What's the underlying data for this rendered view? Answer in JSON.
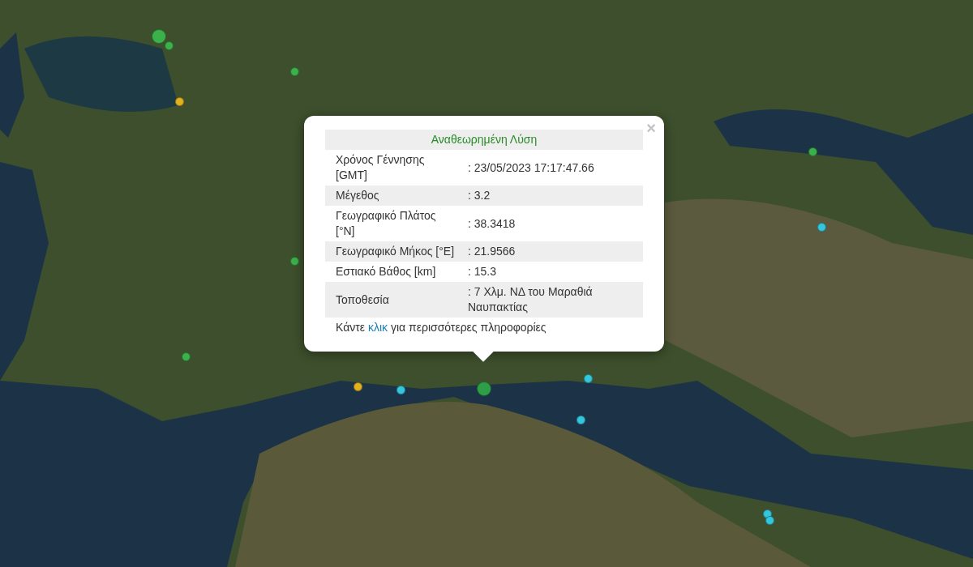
{
  "popup": {
    "close": "×",
    "title": "Αναθεωρημένη Λύση",
    "rows": [
      {
        "label": "Χρόνος Γέννησης [GMT]",
        "value": ": 23/05/2023 17:17:47.66"
      },
      {
        "label": "Μέγεθος",
        "value": ": 3.2"
      },
      {
        "label": "Γεωγραφικό Πλάτος [°N]",
        "value": ": 38.3418"
      },
      {
        "label": "Γεωγραφικό Μήκος [°E]",
        "value": ": 21.9566"
      },
      {
        "label": "Εστιακό Βάθος [km]",
        "value": ": 15.3"
      },
      {
        "label": "Τοποθεσία",
        "value": ": 7 Χλμ. ΝΔ του Μαραθιά Ναυπακτίας"
      }
    ],
    "footer": {
      "before": "Κάντε",
      "link": "κλικ",
      "after": "για περισσότερες πληροφορίες"
    }
  },
  "markers": [
    {
      "kind": "major",
      "color": "#3cb04a"
    },
    {
      "kind": "minor",
      "color": "#3cb04a"
    },
    {
      "kind": "minor",
      "color": "#e2b21e"
    },
    {
      "kind": "minor",
      "color": "#3cb04a"
    },
    {
      "kind": "minor",
      "color": "#3cb04a"
    },
    {
      "kind": "minor",
      "color": "#3cb04a"
    },
    {
      "kind": "minor",
      "color": "#3cb04a"
    },
    {
      "kind": "minor",
      "color": "#33c6dc"
    },
    {
      "kind": "minor",
      "color": "#e2b21e"
    },
    {
      "kind": "minor",
      "color": "#33c6dc"
    },
    {
      "kind": "major",
      "color": "#2e9e48"
    },
    {
      "kind": "minor",
      "color": "#33c6dc"
    },
    {
      "kind": "minor",
      "color": "#33c6dc"
    },
    {
      "kind": "minor",
      "color": "#33c6dc"
    },
    {
      "kind": "minor",
      "color": "#33c6dc"
    }
  ]
}
